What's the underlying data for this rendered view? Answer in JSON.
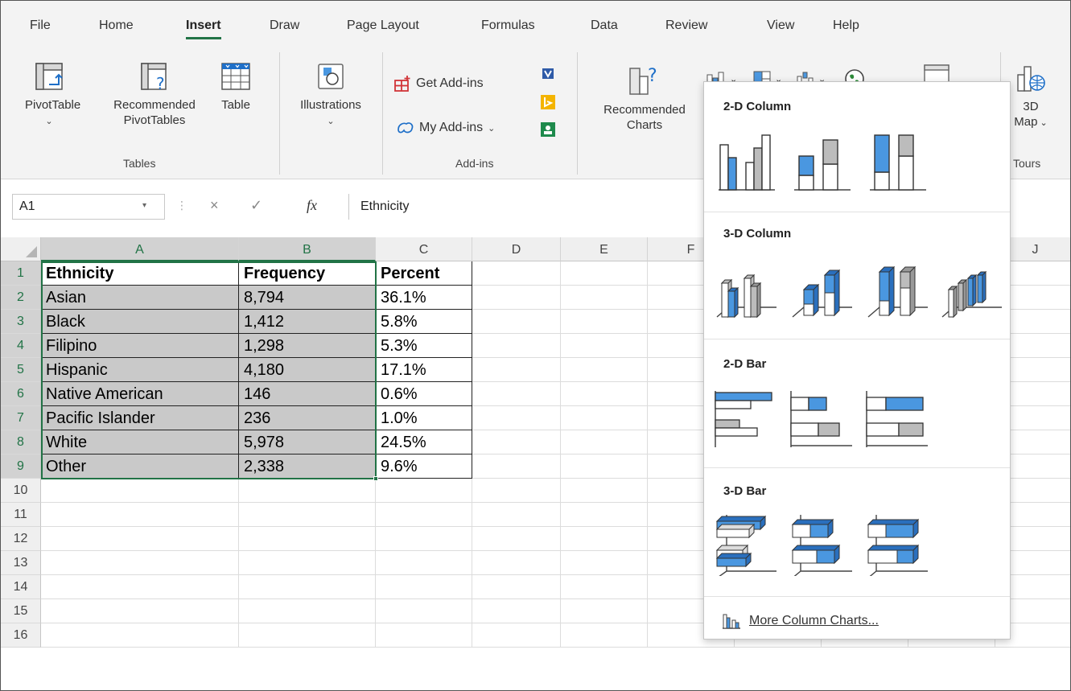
{
  "ribbon_tabs": [
    "File",
    "Home",
    "Insert",
    "Draw",
    "Page Layout",
    "Formulas",
    "Data",
    "Review",
    "View",
    "Help"
  ],
  "active_tab": "Insert",
  "tables_group": {
    "pivottable": "PivotTable",
    "recommended_line1": "Recommended",
    "recommended_line2": "PivotTables",
    "table": "Table",
    "label": "Tables"
  },
  "illustrations": "Illustrations",
  "addins_group": {
    "get_addins": "Get Add-ins",
    "my_addins": "My Add-ins",
    "label": "Add-ins"
  },
  "recommended_charts": {
    "line1": "Recommended",
    "line2": "Charts"
  },
  "map3d": {
    "line1": "3D",
    "line2": "Map",
    "group": "Tours"
  },
  "formula_bar": {
    "name_box": "A1",
    "cancel": "×",
    "enter": "✓",
    "fx": "fx",
    "content": "Ethnicity"
  },
  "columns": [
    "A",
    "B",
    "C",
    "D",
    "E",
    "F",
    "J"
  ],
  "rows": [
    "1",
    "2",
    "3",
    "4",
    "5",
    "6",
    "7",
    "8",
    "9",
    "10",
    "11",
    "12",
    "13",
    "14",
    "15",
    "16"
  ],
  "table": {
    "headers": [
      "Ethnicity",
      "Frequency",
      "Percent"
    ],
    "data": [
      [
        "Asian",
        "8,794",
        "36.1%"
      ],
      [
        "Black",
        "1,412",
        "5.8%"
      ],
      [
        "Filipino",
        "1,298",
        "5.3%"
      ],
      [
        "Hispanic",
        "4,180",
        "17.1%"
      ],
      [
        "Native American",
        "146",
        "0.6%"
      ],
      [
        "Pacific Islander",
        "236",
        "1.0%"
      ],
      [
        "White",
        "5,978",
        "24.5%"
      ],
      [
        "Other",
        "2,338",
        "9.6%"
      ]
    ]
  },
  "chart_menu": {
    "sections": [
      "2-D Column",
      "3-D Column",
      "2-D Bar",
      "3-D Bar"
    ],
    "more": "More Column Charts..."
  },
  "colors": {
    "accent_green": "#217346",
    "chart_blue": "#4a97e0",
    "chart_gray": "#bcbcbc",
    "selection_gray": "#c9c9c9"
  }
}
